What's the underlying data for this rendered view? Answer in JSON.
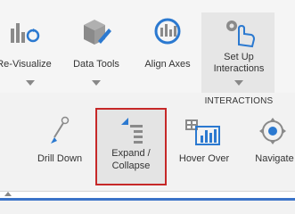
{
  "ribbon": {
    "top_tools": [
      {
        "label": "Re-Visualize",
        "icon": "re-visualize-icon"
      },
      {
        "label": "Data Tools",
        "icon": "data-tools-icon"
      },
      {
        "label": "Align Axes",
        "icon": "align-axes-icon"
      },
      {
        "label_line1": "Set Up",
        "label_line2": "Interactions",
        "icon": "hand-cursor-gear-icon"
      }
    ],
    "group_label": "INTERACTIONS",
    "interaction_tools": [
      {
        "label": "Drill Down",
        "icon": "drill-down-icon"
      },
      {
        "label_line1": "Expand /",
        "label_line2": "Collapse",
        "icon": "expand-collapse-icon",
        "selected": true
      },
      {
        "label": "Hover Over",
        "icon": "hover-over-icon"
      },
      {
        "label": "Navigate",
        "icon": "navigate-icon"
      }
    ]
  },
  "colors": {
    "accent_blue": "#2b79d0",
    "highlight_red": "#c62828",
    "icon_gray": "#8a8a8a"
  }
}
